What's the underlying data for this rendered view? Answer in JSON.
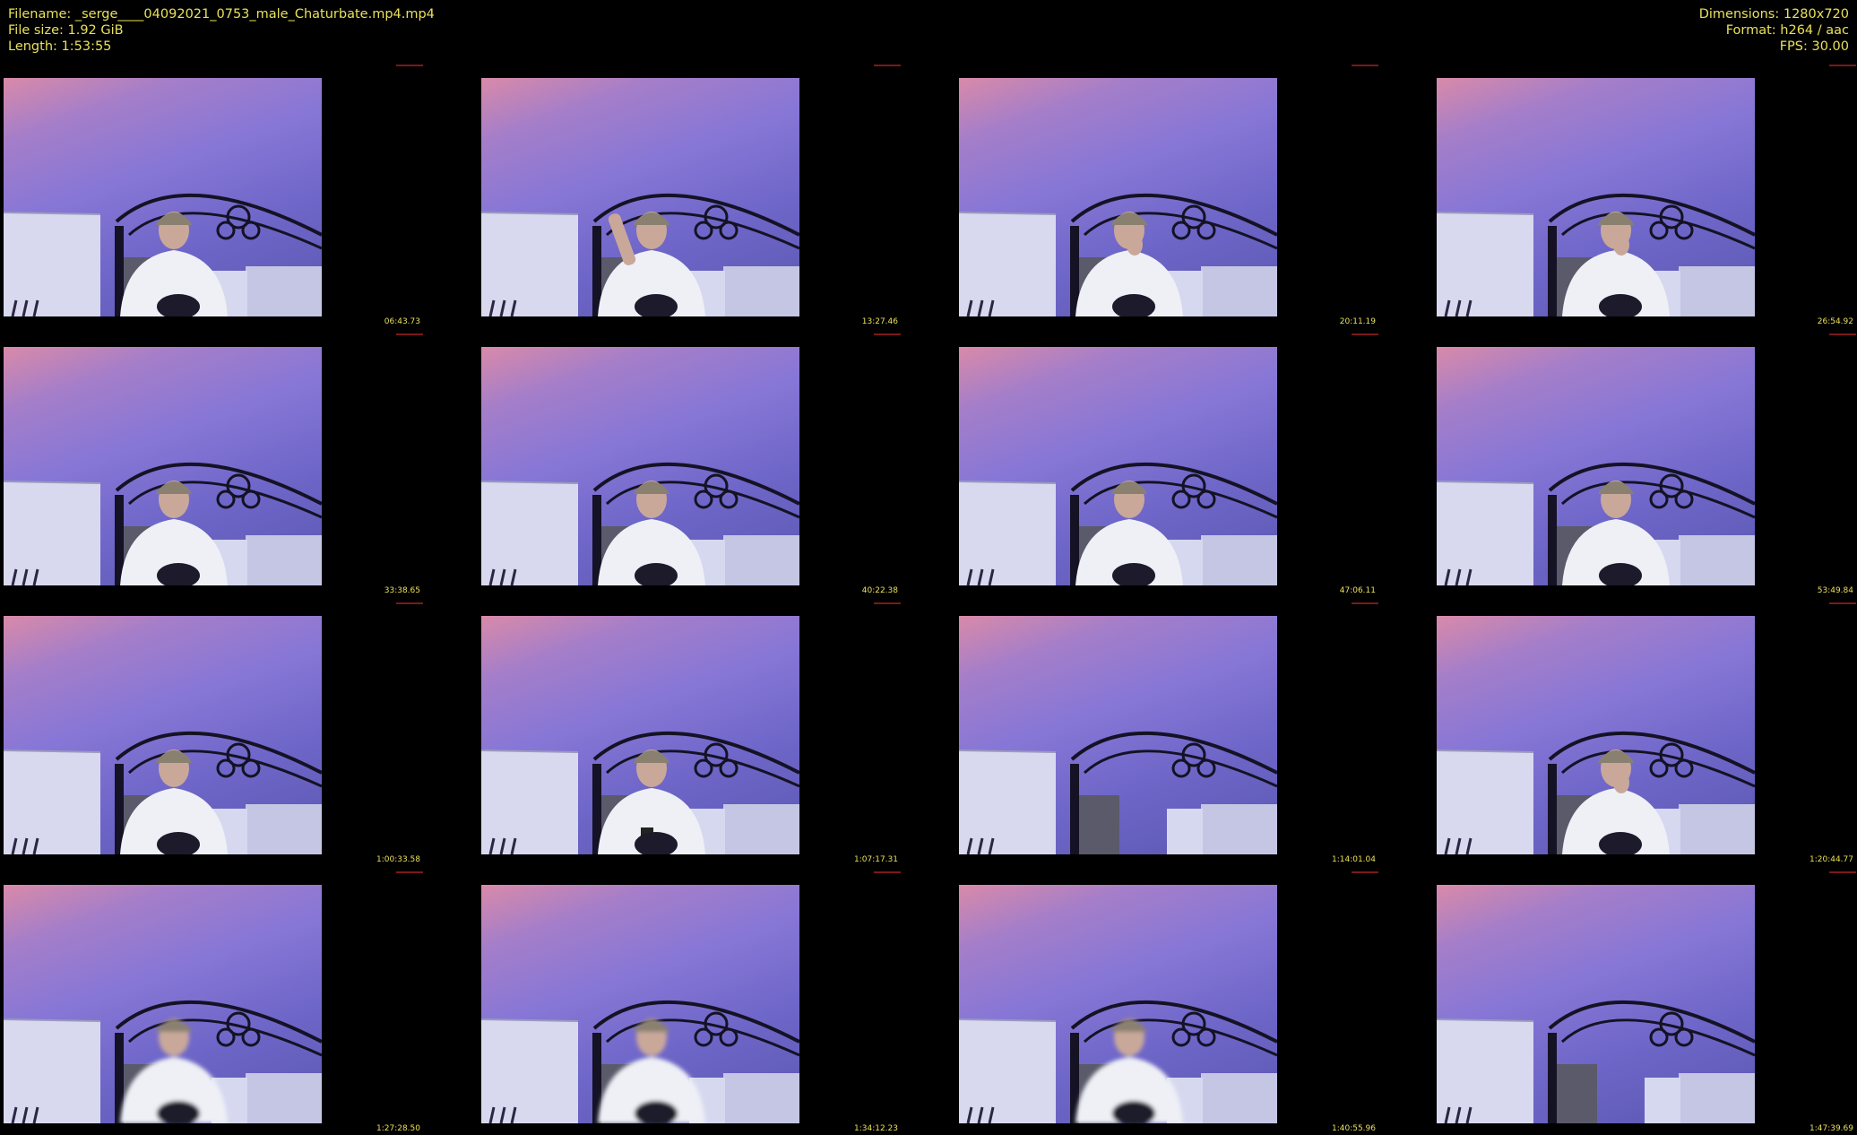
{
  "file_info": {
    "filename_line": "Filename: _serge____04092021_0753_male_Chaturbate.mp4.mp4",
    "filesize_line": "File size: 1.92 GiB",
    "length_line": "Length: 1:53:55"
  },
  "media_info": {
    "dimensions_line": "Dimensions: 1280x720",
    "format_line": "Format: h264 / aac",
    "fps_line": "FPS: 30.00"
  },
  "colors": {
    "header_text": "#e8e05a",
    "background": "#000000"
  },
  "thumbnails": [
    {
      "timestamp": "06:43.73",
      "subject": "seated",
      "pose": "arms-down"
    },
    {
      "timestamp": "13:27.46",
      "subject": "seated",
      "pose": "hand-up"
    },
    {
      "timestamp": "20:11.19",
      "subject": "seated",
      "pose": "hand-chin"
    },
    {
      "timestamp": "26:54.92",
      "subject": "seated",
      "pose": "hand-chin-right"
    },
    {
      "timestamp": "33:38.65",
      "subject": "seated",
      "pose": "arms-down"
    },
    {
      "timestamp": "40:22.38",
      "subject": "seated",
      "pose": "arms-down"
    },
    {
      "timestamp": "47:06.11",
      "subject": "seated",
      "pose": "leaning"
    },
    {
      "timestamp": "53:49.84",
      "subject": "seated",
      "pose": "arms-down-right"
    },
    {
      "timestamp": "1:00:33.58",
      "subject": "seated",
      "pose": "arms-down"
    },
    {
      "timestamp": "1:07:17.31",
      "subject": "seated",
      "pose": "phone"
    },
    {
      "timestamp": "1:14:01.04",
      "subject": "empty",
      "pose": "none"
    },
    {
      "timestamp": "1:20:44.77",
      "subject": "seated",
      "pose": "hand-face-right"
    },
    {
      "timestamp": "1:27:28.50",
      "subject": "blurred",
      "pose": "arms-down"
    },
    {
      "timestamp": "1:34:12.23",
      "subject": "blurred",
      "pose": "leaning"
    },
    {
      "timestamp": "1:40:55.96",
      "subject": "blurred",
      "pose": "arms-down"
    },
    {
      "timestamp": "1:47:39.69",
      "subject": "empty",
      "pose": "none"
    }
  ]
}
